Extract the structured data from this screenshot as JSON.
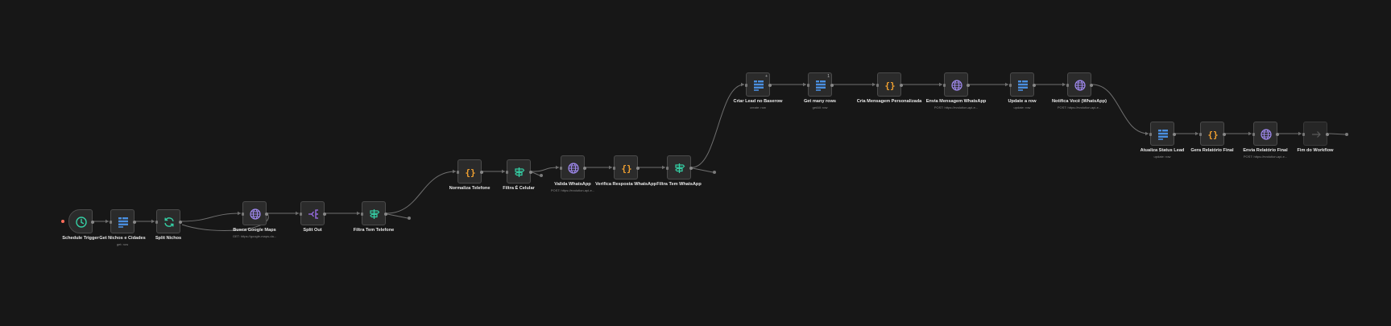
{
  "workflow": {
    "colors": {
      "background": "#171717",
      "node_fill": "#2b2b2b",
      "node_border": "#4b4b4b",
      "edge": "#6f6f6f",
      "trigger_icon": "#35d0a5",
      "table_icon": "#4a8fe0",
      "globe_icon": "#a08af0",
      "code_icon": "#f0a030",
      "filter_icon": "#35d0a5",
      "split_icon": "#a070f0",
      "start_marker": "#ff6d5a"
    },
    "nodes": [
      {
        "id": "n1",
        "label": "Schedule Trigger",
        "sub": "",
        "icon": "clock-icon",
        "kind": "trigger"
      },
      {
        "id": "n2",
        "label": "Get Nichos e Cidades",
        "sub": "get: row",
        "icon": "table-icon"
      },
      {
        "id": "n3",
        "label": "Split Nichos",
        "sub": "",
        "icon": "loop-icon"
      },
      {
        "id": "n4",
        "label": "Busca Google Maps",
        "sub": "GET: https://google-maps-da...",
        "icon": "globe-icon"
      },
      {
        "id": "n5",
        "label": "Split Out",
        "sub": "",
        "icon": "split-out-icon"
      },
      {
        "id": "n6",
        "label": "Filtra Tem Telefone",
        "sub": "",
        "icon": "filter-icon"
      },
      {
        "id": "n7",
        "label": "Normaliza Telefone",
        "sub": "",
        "icon": "code-icon"
      },
      {
        "id": "n8",
        "label": "Filtra É Celular",
        "sub": "",
        "icon": "filter-icon"
      },
      {
        "id": "n9",
        "label": "Valida WhatsApp",
        "sub": "POST: https://evolution-api-e...",
        "icon": "globe-icon"
      },
      {
        "id": "n10",
        "label": "Verifica Resposta WhatsApp",
        "sub": "",
        "icon": "code-icon"
      },
      {
        "id": "n11",
        "label": "Filtra Tem WhatsApp",
        "sub": "",
        "icon": "filter-icon"
      },
      {
        "id": "n12",
        "label": "Criar Lead no Baserow",
        "sub": "create: row",
        "icon": "table-icon",
        "badge": "+"
      },
      {
        "id": "n13",
        "label": "Get many rows",
        "sub": "getAll: row",
        "icon": "table-icon",
        "badge": "1"
      },
      {
        "id": "n14",
        "label": "Cria Mensagem Personalizada",
        "sub": "",
        "icon": "code-icon"
      },
      {
        "id": "n15",
        "label": "Envia Mensagem WhatsApp",
        "sub": "POST: https://evolution-api-e...",
        "icon": "globe-icon"
      },
      {
        "id": "n16",
        "label": "Update a row",
        "sub": "update: row",
        "icon": "table-icon"
      },
      {
        "id": "n17",
        "label": "Notifica Você (WhatsApp)",
        "sub": "POST: https://evolution-api-e...",
        "icon": "globe-icon"
      },
      {
        "id": "n18",
        "label": "Atualiza Status Lead",
        "sub": "update: row",
        "icon": "table-icon"
      },
      {
        "id": "n19",
        "label": "Gera Relatório Final",
        "sub": "",
        "icon": "code-icon"
      },
      {
        "id": "n20",
        "label": "Envia Relatório Final",
        "sub": "POST: https://evolution-api-e...",
        "icon": "globe-icon"
      },
      {
        "id": "n21",
        "label": "Fim do Workflow",
        "sub": "",
        "icon": "arrow-right-icon",
        "kind": "disabled"
      }
    ],
    "edges": [
      [
        "n1",
        "n2"
      ],
      [
        "n2",
        "n3"
      ],
      [
        "n3",
        "n4"
      ],
      [
        "n4",
        "n3"
      ],
      [
        "n4",
        "n5"
      ],
      [
        "n5",
        "n6"
      ],
      [
        "n6",
        "n7"
      ],
      [
        "n7",
        "n8"
      ],
      [
        "n8",
        "n9"
      ],
      [
        "n9",
        "n10"
      ],
      [
        "n10",
        "n11"
      ],
      [
        "n11",
        "n12"
      ],
      [
        "n12",
        "n13"
      ],
      [
        "n13",
        "n14"
      ],
      [
        "n14",
        "n15"
      ],
      [
        "n15",
        "n16"
      ],
      [
        "n16",
        "n17"
      ],
      [
        "n17",
        "n18"
      ],
      [
        "n18",
        "n19"
      ],
      [
        "n19",
        "n20"
      ],
      [
        "n20",
        "n21"
      ]
    ]
  }
}
